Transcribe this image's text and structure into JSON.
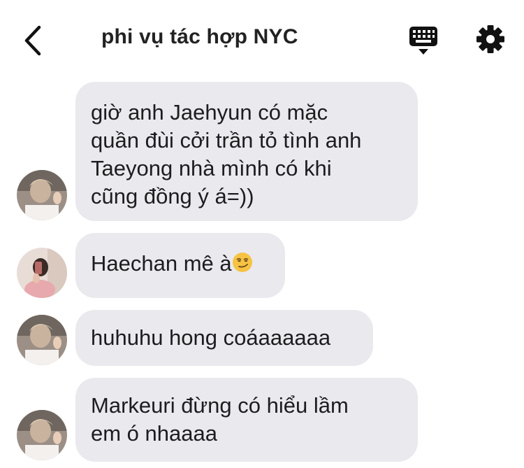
{
  "header": {
    "title": "phi vụ tác hợp NYC",
    "back_icon": "chevron-left-icon",
    "keyboard_icon": "keyboard-icon",
    "settings_icon": "gear-icon"
  },
  "messages": [
    {
      "sender": "member-1",
      "lines": [
        "giờ anh Jaehyun có mặc",
        "quần đùi cởi trần tỏ tình anh",
        "Taeyong nhà mình có khi",
        "cũng đồng ý á=))"
      ]
    },
    {
      "sender": "member-2",
      "lines": [
        "Haechan mê à"
      ],
      "emoji": "smirking-face-emoji"
    },
    {
      "sender": "member-1",
      "lines": [
        "huhuhu hong coáaaaaaa"
      ]
    },
    {
      "sender": "member-1",
      "lines": [
        "Markeuri đừng có hiểu lầm",
        "em ó nhaaaa"
      ]
    }
  ],
  "colors": {
    "bubble": "#e9e9ee",
    "text": "#1d1d1f",
    "icon": "#111111"
  }
}
